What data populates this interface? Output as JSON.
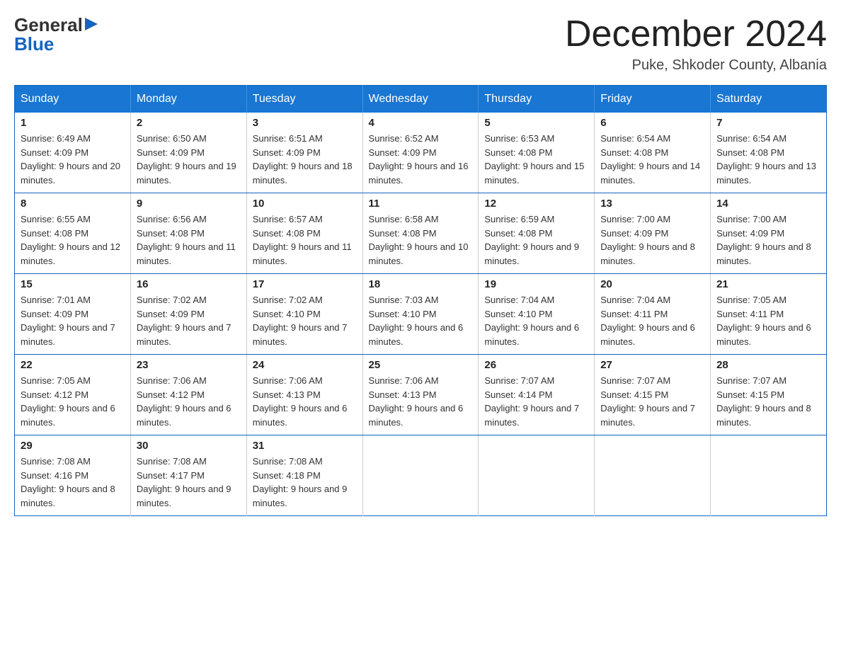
{
  "logo": {
    "general": "General",
    "arrow": "▶",
    "blue": "Blue"
  },
  "title": "December 2024",
  "location": "Puke, Shkoder County, Albania",
  "days_header": [
    "Sunday",
    "Monday",
    "Tuesday",
    "Wednesday",
    "Thursday",
    "Friday",
    "Saturday"
  ],
  "weeks": [
    [
      {
        "day": "1",
        "sunrise": "6:49 AM",
        "sunset": "4:09 PM",
        "daylight": "9 hours and 20 minutes."
      },
      {
        "day": "2",
        "sunrise": "6:50 AM",
        "sunset": "4:09 PM",
        "daylight": "9 hours and 19 minutes."
      },
      {
        "day": "3",
        "sunrise": "6:51 AM",
        "sunset": "4:09 PM",
        "daylight": "9 hours and 18 minutes."
      },
      {
        "day": "4",
        "sunrise": "6:52 AM",
        "sunset": "4:09 PM",
        "daylight": "9 hours and 16 minutes."
      },
      {
        "day": "5",
        "sunrise": "6:53 AM",
        "sunset": "4:08 PM",
        "daylight": "9 hours and 15 minutes."
      },
      {
        "day": "6",
        "sunrise": "6:54 AM",
        "sunset": "4:08 PM",
        "daylight": "9 hours and 14 minutes."
      },
      {
        "day": "7",
        "sunrise": "6:54 AM",
        "sunset": "4:08 PM",
        "daylight": "9 hours and 13 minutes."
      }
    ],
    [
      {
        "day": "8",
        "sunrise": "6:55 AM",
        "sunset": "4:08 PM",
        "daylight": "9 hours and 12 minutes."
      },
      {
        "day": "9",
        "sunrise": "6:56 AM",
        "sunset": "4:08 PM",
        "daylight": "9 hours and 11 minutes."
      },
      {
        "day": "10",
        "sunrise": "6:57 AM",
        "sunset": "4:08 PM",
        "daylight": "9 hours and 11 minutes."
      },
      {
        "day": "11",
        "sunrise": "6:58 AM",
        "sunset": "4:08 PM",
        "daylight": "9 hours and 10 minutes."
      },
      {
        "day": "12",
        "sunrise": "6:59 AM",
        "sunset": "4:08 PM",
        "daylight": "9 hours and 9 minutes."
      },
      {
        "day": "13",
        "sunrise": "7:00 AM",
        "sunset": "4:09 PM",
        "daylight": "9 hours and 8 minutes."
      },
      {
        "day": "14",
        "sunrise": "7:00 AM",
        "sunset": "4:09 PM",
        "daylight": "9 hours and 8 minutes."
      }
    ],
    [
      {
        "day": "15",
        "sunrise": "7:01 AM",
        "sunset": "4:09 PM",
        "daylight": "9 hours and 7 minutes."
      },
      {
        "day": "16",
        "sunrise": "7:02 AM",
        "sunset": "4:09 PM",
        "daylight": "9 hours and 7 minutes."
      },
      {
        "day": "17",
        "sunrise": "7:02 AM",
        "sunset": "4:10 PM",
        "daylight": "9 hours and 7 minutes."
      },
      {
        "day": "18",
        "sunrise": "7:03 AM",
        "sunset": "4:10 PM",
        "daylight": "9 hours and 6 minutes."
      },
      {
        "day": "19",
        "sunrise": "7:04 AM",
        "sunset": "4:10 PM",
        "daylight": "9 hours and 6 minutes."
      },
      {
        "day": "20",
        "sunrise": "7:04 AM",
        "sunset": "4:11 PM",
        "daylight": "9 hours and 6 minutes."
      },
      {
        "day": "21",
        "sunrise": "7:05 AM",
        "sunset": "4:11 PM",
        "daylight": "9 hours and 6 minutes."
      }
    ],
    [
      {
        "day": "22",
        "sunrise": "7:05 AM",
        "sunset": "4:12 PM",
        "daylight": "9 hours and 6 minutes."
      },
      {
        "day": "23",
        "sunrise": "7:06 AM",
        "sunset": "4:12 PM",
        "daylight": "9 hours and 6 minutes."
      },
      {
        "day": "24",
        "sunrise": "7:06 AM",
        "sunset": "4:13 PM",
        "daylight": "9 hours and 6 minutes."
      },
      {
        "day": "25",
        "sunrise": "7:06 AM",
        "sunset": "4:13 PM",
        "daylight": "9 hours and 6 minutes."
      },
      {
        "day": "26",
        "sunrise": "7:07 AM",
        "sunset": "4:14 PM",
        "daylight": "9 hours and 7 minutes."
      },
      {
        "day": "27",
        "sunrise": "7:07 AM",
        "sunset": "4:15 PM",
        "daylight": "9 hours and 7 minutes."
      },
      {
        "day": "28",
        "sunrise": "7:07 AM",
        "sunset": "4:15 PM",
        "daylight": "9 hours and 8 minutes."
      }
    ],
    [
      {
        "day": "29",
        "sunrise": "7:08 AM",
        "sunset": "4:16 PM",
        "daylight": "9 hours and 8 minutes."
      },
      {
        "day": "30",
        "sunrise": "7:08 AM",
        "sunset": "4:17 PM",
        "daylight": "9 hours and 9 minutes."
      },
      {
        "day": "31",
        "sunrise": "7:08 AM",
        "sunset": "4:18 PM",
        "daylight": "9 hours and 9 minutes."
      },
      null,
      null,
      null,
      null
    ]
  ]
}
